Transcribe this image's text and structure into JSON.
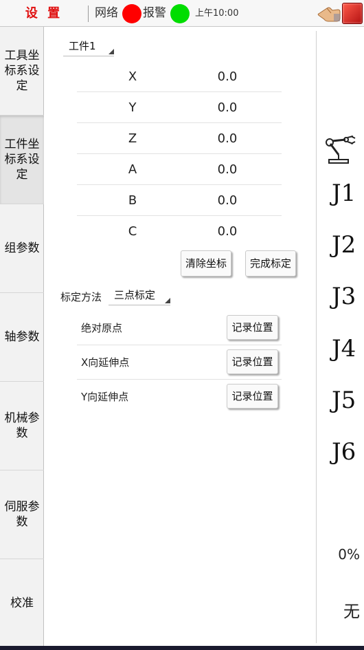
{
  "header": {
    "title": "设 置",
    "network_label": "网络",
    "alarm_label": "报警",
    "time": "上午10:00",
    "status_colors": {
      "network": "#ff0000",
      "alarm": "#00dd00"
    }
  },
  "sidebar": {
    "items": [
      {
        "label": "工具坐标系设定"
      },
      {
        "label": "工件坐标系设定"
      },
      {
        "label": "组参数"
      },
      {
        "label": "轴参数"
      },
      {
        "label": "机械参数"
      },
      {
        "label": "伺服参数"
      },
      {
        "label": "校准"
      }
    ],
    "active_index": 1
  },
  "main": {
    "workpiece_select": "工件1",
    "coords": [
      {
        "axis": "X",
        "value": "0.0"
      },
      {
        "axis": "Y",
        "value": "0.0"
      },
      {
        "axis": "Z",
        "value": "0.0"
      },
      {
        "axis": "A",
        "value": "0.0"
      },
      {
        "axis": "B",
        "value": "0.0"
      },
      {
        "axis": "C",
        "value": "0.0"
      }
    ],
    "clear_button": "清除坐标",
    "finish_button": "完成标定",
    "method_label": "标定方法",
    "method_value": "三点标定",
    "calibration_points": [
      {
        "label": "绝对原点",
        "button": "记录位置"
      },
      {
        "label": "X向延伸点",
        "button": "记录位置"
      },
      {
        "label": "Y向延伸点",
        "button": "记录位置"
      }
    ]
  },
  "right_panel": {
    "joints": [
      "J1",
      "J2",
      "J3",
      "J4",
      "J5",
      "J6"
    ],
    "speed": "0%",
    "mode": "无"
  },
  "icons": {
    "hand": "hand-icon",
    "stop": "emergency-stop-icon",
    "robot": "robot-arm-icon"
  }
}
